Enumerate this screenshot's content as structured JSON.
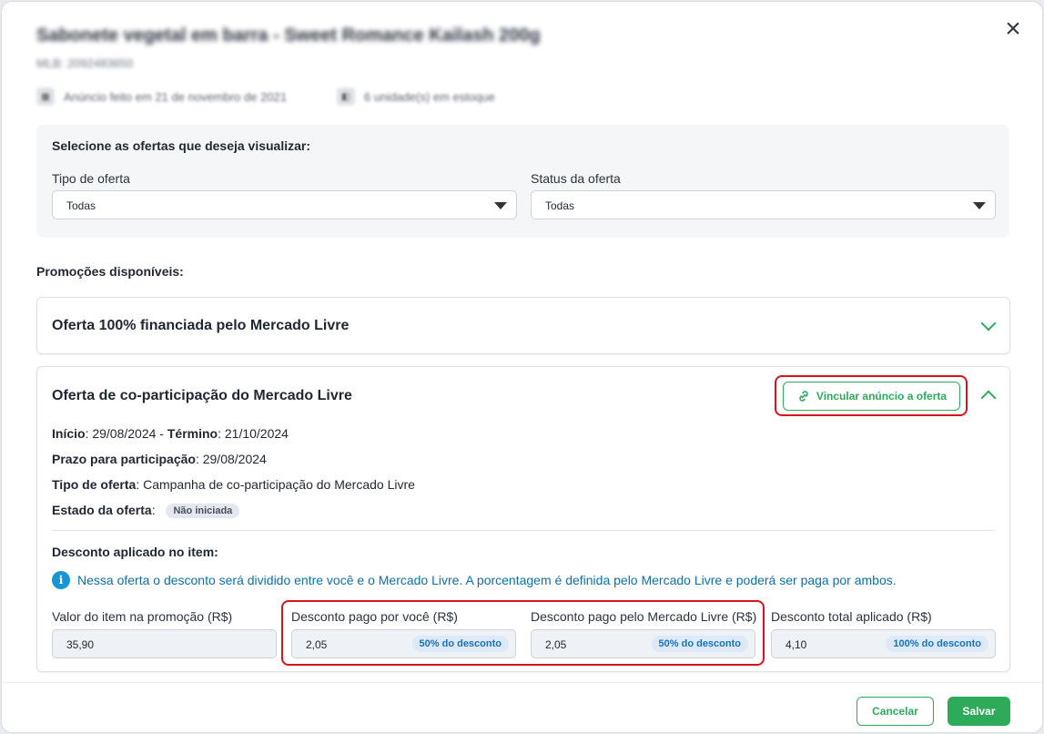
{
  "header": {
    "title": "Sabonete vegetal em barra - Sweet Romance Kailash 200g",
    "mlb": "MLB: 2092483650",
    "meta_listed": "Anúncio feito em 21 de novembro de 2021",
    "meta_stock": "6 unidade(s) em estoque",
    "close_icon": "close-icon"
  },
  "filters": {
    "heading": "Selecione as ofertas que deseja visualizar:",
    "type_label": "Tipo de oferta",
    "type_value": "Todas",
    "status_label": "Status da oferta",
    "status_value": "Todas"
  },
  "promotions_label": "Promoções disponíveis:",
  "offers": [
    {
      "title": "Oferta 100% financiada pelo Mercado Livre",
      "expanded": false
    },
    {
      "title": "Oferta de co-participação do Mercado Livre",
      "expanded": true,
      "link_button": "Vincular anúncio a oferta",
      "start_label": "Início",
      "start_value": ": 29/08/2024 - ",
      "end_label": "Término",
      "end_value": ": 21/10/2024",
      "deadline_label": "Prazo para participação",
      "deadline_value": ": 29/08/2024",
      "type_label": "Tipo de oferta",
      "type_value": ": Campanha de co-participação do Mercado Livre",
      "state_label": "Estado da oferta",
      "state_sep": ":",
      "state_badge": "Não iniciada",
      "discount_heading": "Desconto aplicado no item:",
      "info_note": "Nessa oferta o desconto será dividido entre você e o Mercado Livre. A porcentagem é definida pelo Mercado Livre e poderá ser paga por ambos.",
      "fields": [
        {
          "label": "Valor do item na promoção (R$)",
          "value": "35,90",
          "pct": ""
        },
        {
          "label": "Desconto pago por você (R$)",
          "value": "2,05",
          "pct": "50% do desconto"
        },
        {
          "label": "Desconto pago pelo Mercado Livre (R$)",
          "value": "2,05",
          "pct": "50% do desconto"
        },
        {
          "label": "Desconto total aplicado (R$)",
          "value": "4,10",
          "pct": "100% do desconto"
        }
      ]
    }
  ],
  "footer": {
    "cancel": "Cancelar",
    "save": "Salvar"
  },
  "colors": {
    "accent": "#2eaa5b",
    "highlight": "#d6141d",
    "info": "#1695d3"
  }
}
